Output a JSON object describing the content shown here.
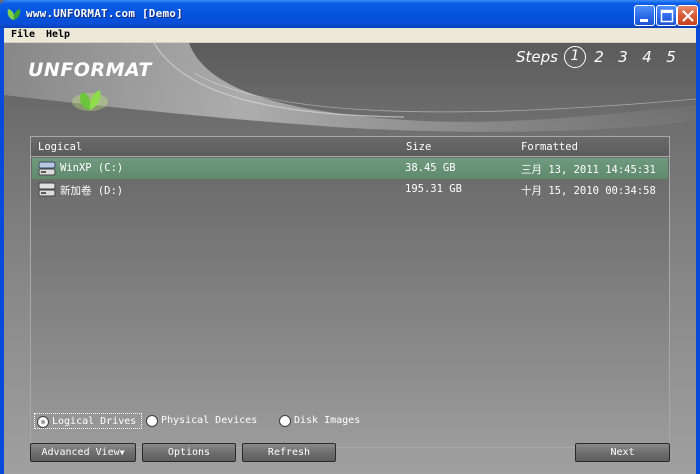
{
  "window": {
    "title": "www.UNFORMAT.com [Demo]",
    "colors": {
      "titlebar": "#0553e0",
      "close": "#d85a35"
    }
  },
  "menu": {
    "items": [
      "File",
      "Help"
    ]
  },
  "banner": {
    "logo": "UNFORMAT",
    "steps_label": "Steps",
    "steps": [
      "1",
      "2",
      "3",
      "4",
      "5"
    ],
    "active_step": "1"
  },
  "list": {
    "columns": [
      "Logical",
      "Size",
      "Formatted"
    ],
    "rows": [
      {
        "icon": "hard-drive-icon",
        "name": "WinXP (C:)",
        "size": "38.45 GB",
        "formatted": "三月 13, 2011 14:45:31",
        "selected": true
      },
      {
        "icon": "hard-drive-icon",
        "name": "新加卷 (D:)",
        "size": "195.31 GB",
        "formatted": "十月 15, 2010 00:34:58",
        "selected": false
      }
    ]
  },
  "view_options": {
    "items": [
      "Logical Drives",
      "Physical Devices",
      "Disk Images"
    ],
    "selected": "Logical Drives"
  },
  "buttons": {
    "advanced_view": "Advanced View",
    "options": "Options",
    "refresh": "Refresh",
    "next": "Next"
  }
}
